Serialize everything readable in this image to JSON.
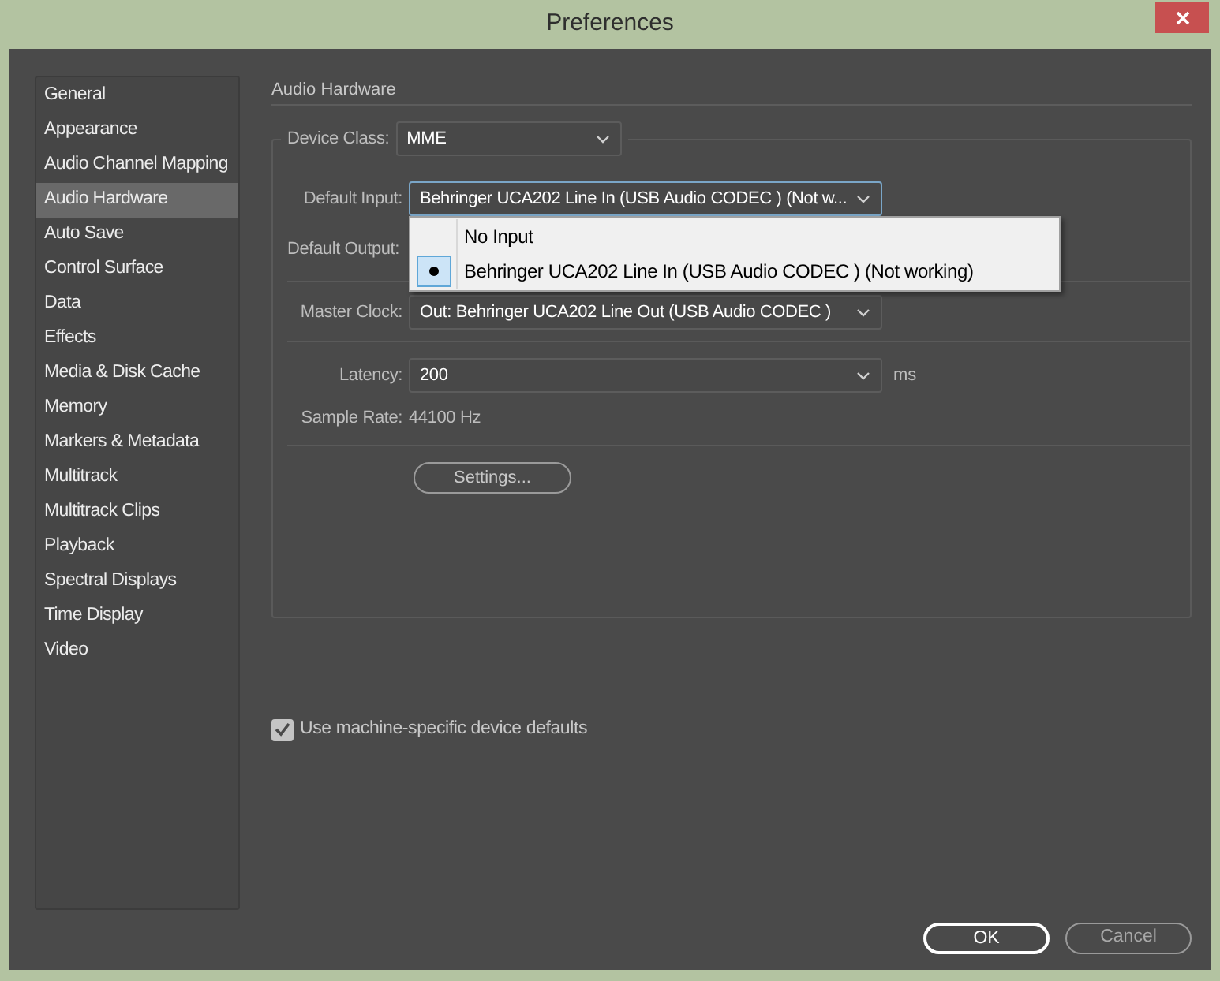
{
  "window": {
    "title": "Preferences"
  },
  "sidebar": {
    "items": [
      {
        "label": "General",
        "selected": false
      },
      {
        "label": "Appearance",
        "selected": false
      },
      {
        "label": "Audio Channel Mapping",
        "selected": false
      },
      {
        "label": "Audio Hardware",
        "selected": true
      },
      {
        "label": "Auto Save",
        "selected": false
      },
      {
        "label": "Control Surface",
        "selected": false
      },
      {
        "label": "Data",
        "selected": false
      },
      {
        "label": "Effects",
        "selected": false
      },
      {
        "label": "Media & Disk Cache",
        "selected": false
      },
      {
        "label": "Memory",
        "selected": false
      },
      {
        "label": "Markers & Metadata",
        "selected": false
      },
      {
        "label": "Multitrack",
        "selected": false
      },
      {
        "label": "Multitrack Clips",
        "selected": false
      },
      {
        "label": "Playback",
        "selected": false
      },
      {
        "label": "Spectral Displays",
        "selected": false
      },
      {
        "label": "Time Display",
        "selected": false
      },
      {
        "label": "Video",
        "selected": false
      }
    ]
  },
  "section": {
    "title": "Audio Hardware"
  },
  "device_class": {
    "label": "Device Class:",
    "value": "MME"
  },
  "default_input": {
    "label": "Default Input:",
    "value": "Behringer UCA202 Line In (USB Audio CODEC ) (Not w...",
    "expanded": true,
    "options": [
      {
        "label": "No Input",
        "selected": false
      },
      {
        "label": "Behringer UCA202 Line In (USB Audio CODEC ) (Not working)",
        "selected": true
      }
    ]
  },
  "default_output": {
    "label": "Default Output:"
  },
  "master_clock": {
    "label": "Master Clock:",
    "value": "Out: Behringer UCA202 Line Out (USB Audio CODEC )"
  },
  "latency": {
    "label": "Latency:",
    "value": "200",
    "unit": "ms"
  },
  "sample_rate": {
    "label": "Sample Rate:",
    "value": "44100 Hz"
  },
  "settings_button": "Settings...",
  "machine_defaults": {
    "label": "Use machine-specific device defaults",
    "checked": true
  },
  "buttons": [
    {
      "label": "OK",
      "kind": "default"
    },
    {
      "label": "Cancel",
      "kind": "normal"
    }
  ]
}
